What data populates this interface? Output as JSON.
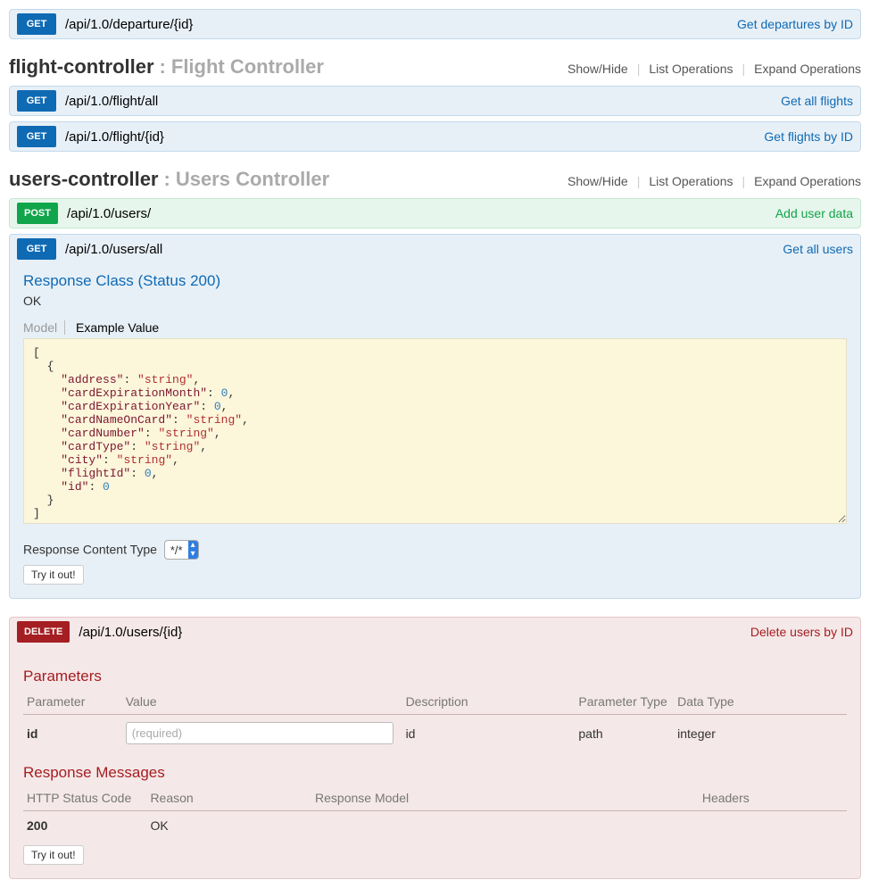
{
  "ops": {
    "departure_id": {
      "method": "GET",
      "path": "/api/1.0/departure/{id}",
      "summary": "Get departures by ID"
    },
    "flight_all": {
      "method": "GET",
      "path": "/api/1.0/flight/all",
      "summary": "Get all flights"
    },
    "flight_id": {
      "method": "GET",
      "path": "/api/1.0/flight/{id}",
      "summary": "Get flights by ID"
    },
    "users_post": {
      "method": "POST",
      "path": "/api/1.0/users/",
      "summary": "Add user data"
    },
    "users_all": {
      "method": "GET",
      "path": "/api/1.0/users/all",
      "summary": "Get all users"
    },
    "users_delete": {
      "method": "DELETE",
      "path": "/api/1.0/users/{id}",
      "summary": "Delete users by ID"
    }
  },
  "controllers": {
    "flight": {
      "name": "flight-controller",
      "desc": "Flight Controller"
    },
    "users": {
      "name": "users-controller",
      "desc": "Users Controller"
    }
  },
  "controller_actions": {
    "showhide": "Show/Hide",
    "list": "List Operations",
    "expand": "Expand Operations"
  },
  "expanded_get": {
    "response_class_label": "Response Class (Status 200)",
    "ok": "OK",
    "model_tab": "Model",
    "example_tab": "Example Value",
    "example_json": {
      "address": "string",
      "cardExpirationMonth": 0,
      "cardExpirationYear": 0,
      "cardNameOnCard": "string",
      "cardNumber": "string",
      "cardType": "string",
      "city": "string",
      "flightId": 0,
      "id": 0
    },
    "resp_ct_label": "Response Content Type",
    "resp_ct_value": "*/*",
    "try_label": "Try it out!"
  },
  "expanded_delete": {
    "params_title": "Parameters",
    "headers": {
      "parameter": "Parameter",
      "value": "Value",
      "description": "Description",
      "ptype": "Parameter Type",
      "dtype": "Data Type"
    },
    "param": {
      "name": "id",
      "placeholder": "(required)",
      "description": "id",
      "ptype": "path",
      "dtype": "integer"
    },
    "respmsg_title": "Response Messages",
    "resp_headers": {
      "status": "HTTP Status Code",
      "reason": "Reason",
      "model": "Response Model",
      "headers": "Headers"
    },
    "resp_row": {
      "status": "200",
      "reason": "OK"
    },
    "try_label": "Try it out!"
  }
}
